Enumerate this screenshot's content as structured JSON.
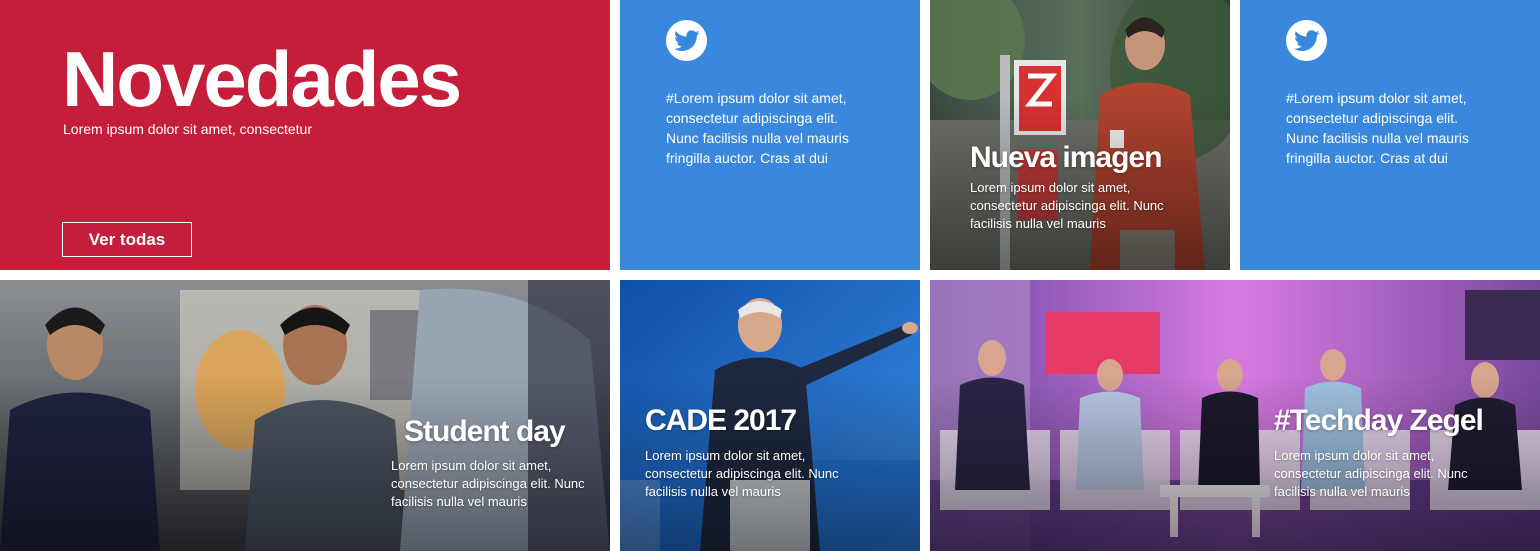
{
  "colors": {
    "red": "#c41e3a",
    "blue": "#3a88de",
    "white": "#ffffff"
  },
  "novedades": {
    "title": "Novedades",
    "subtitle": "Lorem ipsum dolor sit amet, consectetur",
    "button": "Ver todas"
  },
  "tweets": [
    {
      "icon": "twitter-bird-icon",
      "text": "#Lorem ipsum dolor sit amet, consectetur adipiscinga  elit. Nunc facilisis nulla vel mauris fringilla auctor. Cras at dui"
    },
    {
      "icon": "twitter-bird-icon",
      "text": "#Lorem ipsum dolor sit amet, consectetur adipiscinga  elit. Nunc facilisis nulla vel mauris fringilla auctor. Cras at dui"
    }
  ],
  "cards": {
    "nueva_imagen": {
      "title": "Nueva imagen",
      "text": "Lorem ipsum dolor sit amet, consectetur adipiscinga  elit. Nunc facilisis nulla vel mauris"
    },
    "student_day": {
      "title": "Student day",
      "text": "Lorem ipsum dolor sit amet, consectetur adipiscinga  elit. Nunc facilisis nulla vel mauris"
    },
    "cade": {
      "title": "CADE 2017",
      "text": "Lorem ipsum dolor sit amet, consectetur adipiscinga  elit. Nunc facilisis nulla vel mauris"
    },
    "techday": {
      "title": "#Techday Zegel",
      "text": "Lorem ipsum dolor sit amet, consectetur adipiscinga  elit. Nunc facilisis nulla vel mauris"
    }
  }
}
